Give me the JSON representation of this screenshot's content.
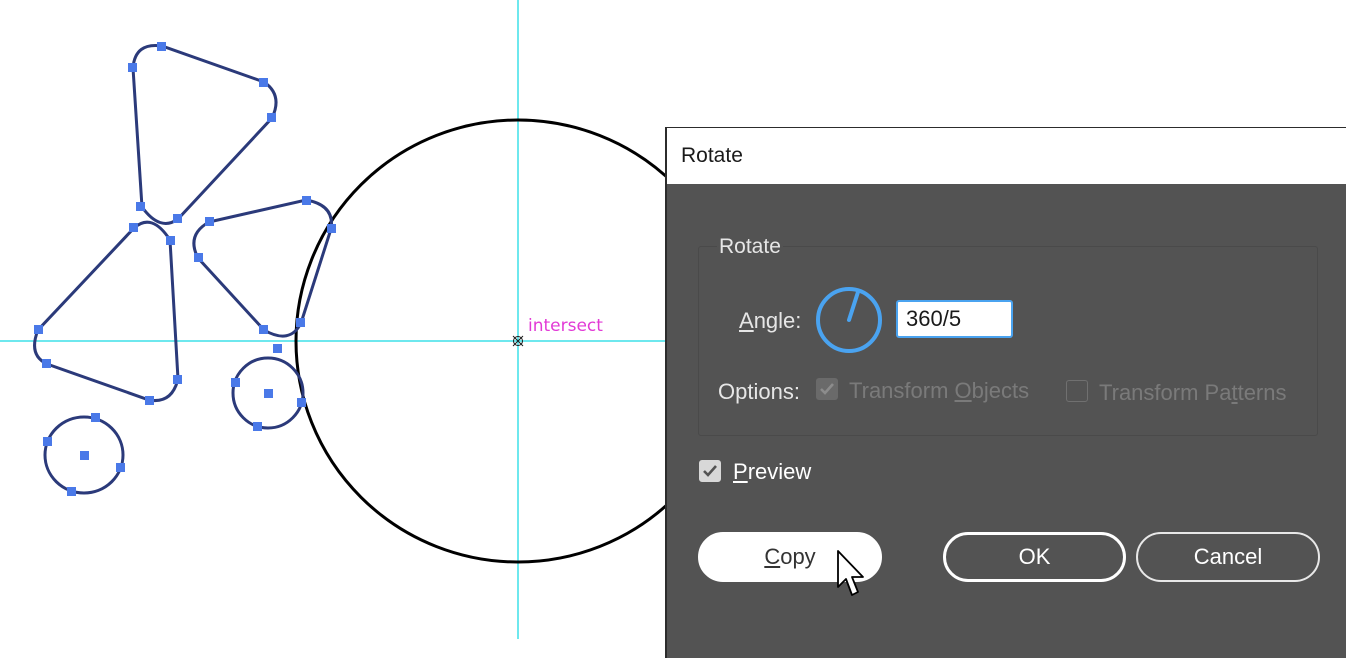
{
  "canvas": {
    "smart_guide_label": "intersect"
  },
  "dialog": {
    "title": "Rotate",
    "group_label": "Rotate",
    "angle": {
      "label_mnemonic": "A",
      "label_rest": "ngle:",
      "value": "360/5"
    },
    "options": {
      "label": "Options:",
      "transform_objects": {
        "pre": "Transform ",
        "mnemonic": "O",
        "post": "bjects",
        "checked": true,
        "enabled": false
      },
      "transform_patterns": {
        "pre": "Transform Pa",
        "mnemonic": "t",
        "post": "terns",
        "checked": false,
        "enabled": false
      }
    },
    "preview": {
      "mnemonic": "P",
      "rest": "review",
      "checked": true
    },
    "buttons": {
      "copy": {
        "mnemonic": "C",
        "rest": "opy"
      },
      "ok": "OK",
      "cancel": "Cancel"
    }
  },
  "colors": {
    "guide": "#3fe0e8",
    "path": "#2b3a7a",
    "anchor": "#4a79e8",
    "smart_label": "#e23ad6",
    "dialog_bg": "#535353",
    "dial": "#4aa3f0"
  }
}
